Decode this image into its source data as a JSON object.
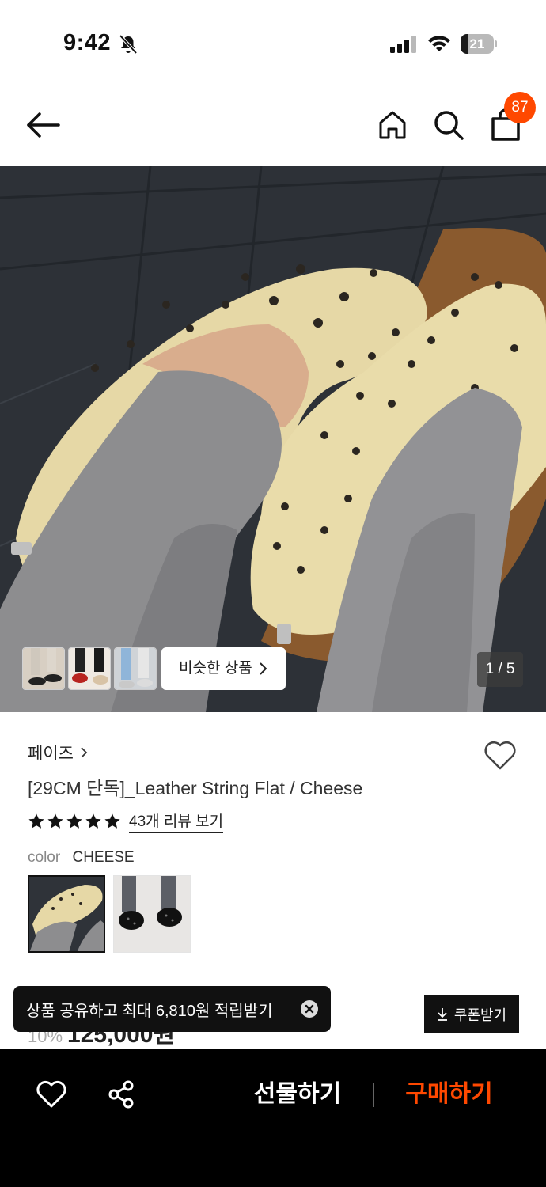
{
  "status_bar": {
    "time": "9:42",
    "battery_level": "21",
    "icons": [
      "bell-muted-icon",
      "signal-icon",
      "wifi-icon",
      "battery-icon"
    ]
  },
  "header": {
    "icons": [
      "back-arrow-icon",
      "home-icon",
      "search-icon",
      "shopping-bag-icon"
    ],
    "cart_count": "87"
  },
  "gallery": {
    "similar_button_label": "비슷한 상품",
    "page_counter": "1 / 5"
  },
  "product": {
    "brand": "페이즈",
    "title": "[29CM 단독]_Leather String Flat / Cheese",
    "rating_stars": 5,
    "review_link": "43개 리뷰 보기",
    "color_label": "color",
    "color_value": "CHEESE",
    "color_options": [
      "cheese",
      "black"
    ]
  },
  "price": {
    "discount_partial": "10%",
    "price_partial": "125,000원"
  },
  "coupon": {
    "label": "쿠폰받기"
  },
  "toast": {
    "message": "상품 공유하고 최대 6,810원 적립받기"
  },
  "bottom_bar": {
    "gift_label": "선물하기",
    "buy_label": "구매하기"
  },
  "colors": {
    "accent": "#ff4800",
    "bar": "#000000"
  }
}
